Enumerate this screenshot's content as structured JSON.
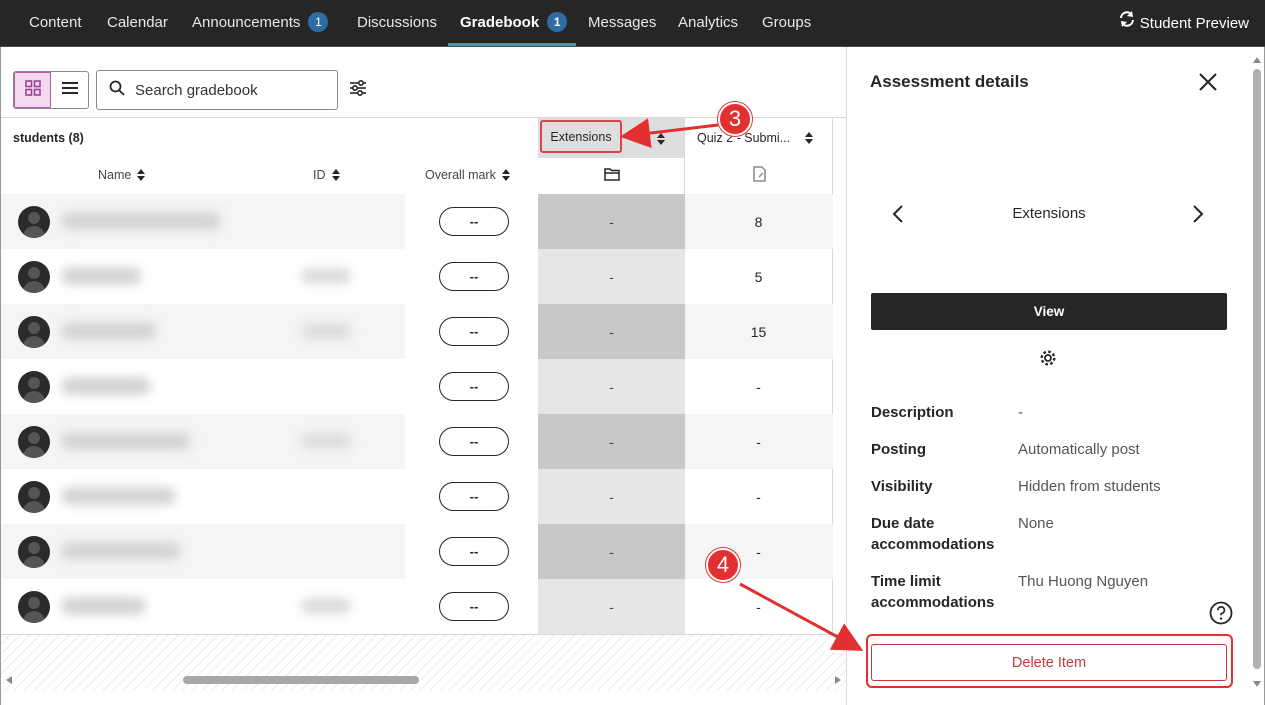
{
  "nav": {
    "tabs": [
      {
        "label": "Content"
      },
      {
        "label": "Calendar"
      },
      {
        "label": "Announcements",
        "badge": "1"
      },
      {
        "label": "Discussions"
      },
      {
        "label": "Gradebook",
        "badge": "1"
      },
      {
        "label": "Messages"
      },
      {
        "label": "Analytics"
      },
      {
        "label": "Groups"
      }
    ],
    "active_tab": "Gradebook",
    "student_preview": "Student Preview"
  },
  "toolbar": {
    "search_placeholder": "Search gradebook"
  },
  "grid": {
    "students_label": "students (8)",
    "columns": {
      "name": "Name",
      "id": "ID",
      "overall": "Overall mark",
      "extensions": "Extensions",
      "quiz": "Quiz 2 - Submi..."
    },
    "rows": [
      {
        "mark": "--",
        "extensions": "-",
        "quiz": "8"
      },
      {
        "mark": "--",
        "extensions": "-",
        "quiz": "5"
      },
      {
        "mark": "--",
        "extensions": "-",
        "quiz": "15"
      },
      {
        "mark": "--",
        "extensions": "-",
        "quiz": "-"
      },
      {
        "mark": "--",
        "extensions": "-",
        "quiz": "-"
      },
      {
        "mark": "--",
        "extensions": "-",
        "quiz": "-"
      },
      {
        "mark": "--",
        "extensions": "-",
        "quiz": "-"
      },
      {
        "mark": "--",
        "extensions": "-",
        "quiz": "-"
      }
    ]
  },
  "panel": {
    "title": "Assessment details",
    "item_name": "Extensions",
    "view_label": "View",
    "details": {
      "description_label": "Description",
      "description_value": "-",
      "posting_label": "Posting",
      "posting_value": "Automatically post",
      "visibility_label": "Visibility",
      "visibility_value": "Hidden from students",
      "due_label_1": "Due date",
      "due_label_2": "accommodations",
      "due_value": "None",
      "time_label_1": "Time limit",
      "time_label_2": "accommodations",
      "time_value": "Thu Huong Nguyen"
    },
    "delete_label": "Delete Item"
  },
  "annotations": {
    "step3": "3",
    "step4": "4",
    "color": "#e23030"
  },
  "colors": {
    "nav_bg": "#262626",
    "badge": "#2e6da4",
    "active_underline": "#4a90d9",
    "view_toggle_active": "#f3d9f0",
    "delete": "#c23b3b"
  }
}
